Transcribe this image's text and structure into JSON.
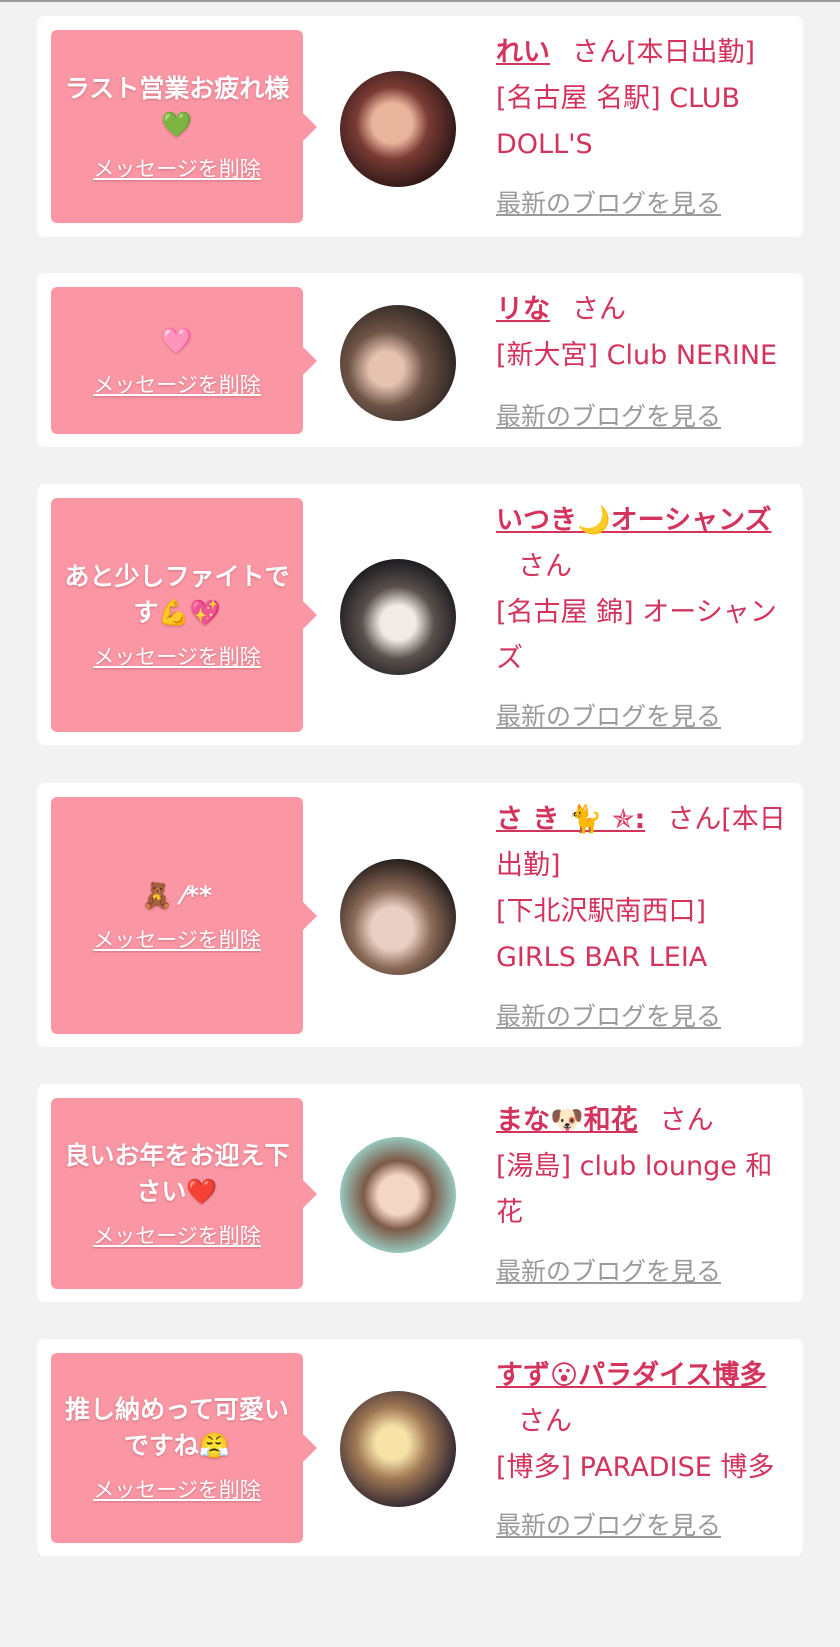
{
  "colors": {
    "bubble": "#fb97a4",
    "accent": "#d3335c",
    "link_gray": "#9a9a9a",
    "background": "#f2f2f2"
  },
  "delete_label": "メッセージを削除",
  "blog_label": "最新のブログを見る",
  "honorific": "さん",
  "cards": [
    {
      "message": "ラスト営業お疲れ様💚",
      "name": "れい",
      "suffix": "[本日出勤]",
      "shop": "[名古屋 名駅] CLUB DOLL'S"
    },
    {
      "message": "🩷",
      "name": "リな",
      "suffix": "",
      "shop": "[新大宮] Club NERINE"
    },
    {
      "message": "あと少しファイトです💪💖",
      "name": "いつき🌙オーシャンズ",
      "suffix": "",
      "shop": "[名古屋 錦] オーシャンズ"
    },
    {
      "message": "🧸 ⁄**",
      "name": "さ き 🐈 ✯:",
      "suffix": "[本日出勤]",
      "shop": "[下北沢駅南西口] GIRLS BAR LEIA"
    },
    {
      "message": "良いお年をお迎え下さい❤️",
      "name": "まな🐶和花",
      "suffix": "",
      "shop": "[湯島] club lounge 和花"
    },
    {
      "message": "推し納めって可愛いですね😤",
      "name": "すず😮パラダイス博多",
      "suffix": "",
      "shop": "[博多] PARADISE 博多"
    }
  ]
}
